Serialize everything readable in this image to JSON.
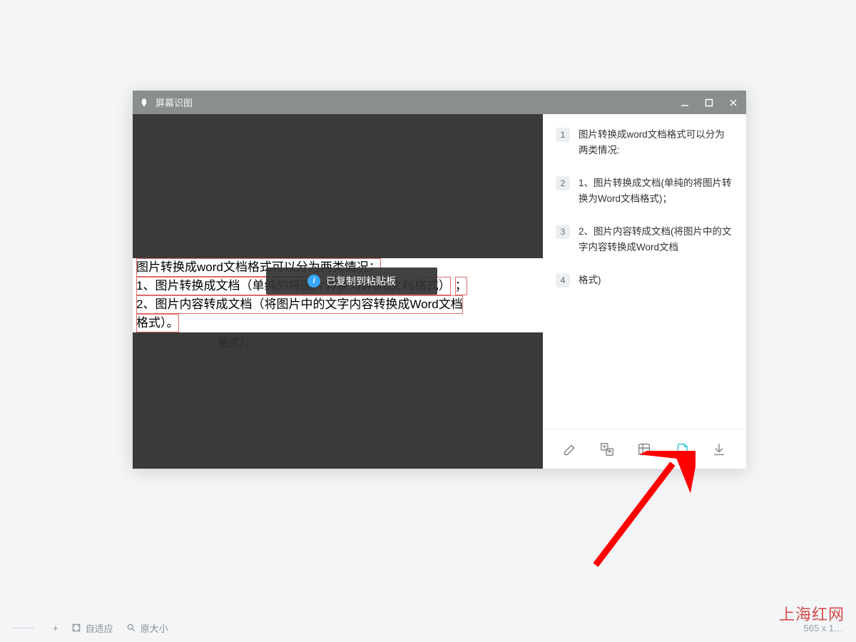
{
  "window": {
    "title": "屏幕识图"
  },
  "ocr_overlay": {
    "line1": "图片转换成word文档格式可以分为两类情况：",
    "line2_a": "1、图片转换成文档（单纯的将图片转换为Word文档格式）",
    "line2_b": "；",
    "line3": "2、图片内容转成文档（将图片中的文字内容转换成Word文档",
    "line4": "格式）。"
  },
  "ghost": "格式）。",
  "toast": "已复制到粘贴板",
  "results": [
    {
      "n": "1",
      "text": "图片转换成word文档格式可以分为两类情况:"
    },
    {
      "n": "2",
      "text": "1、图片转换成文档(单纯的将图片转换为Word文档格式)；"
    },
    {
      "n": "3",
      "text": "2、图片内容转成文档(将图片中的文字内容转换成Word文档"
    },
    {
      "n": "4",
      "text": "格式)"
    }
  ],
  "toolbar_icons": {
    "edit": "edit-icon",
    "translate": "translate-icon",
    "table": "table-icon",
    "copy": "copy-icon",
    "download": "download-icon"
  },
  "bottombar": {
    "zoom_out": "−",
    "zoom_in": "+",
    "fit": "自适应",
    "original": "原大小",
    "dimensions": "565 x 1…"
  },
  "watermark": "上海红网"
}
